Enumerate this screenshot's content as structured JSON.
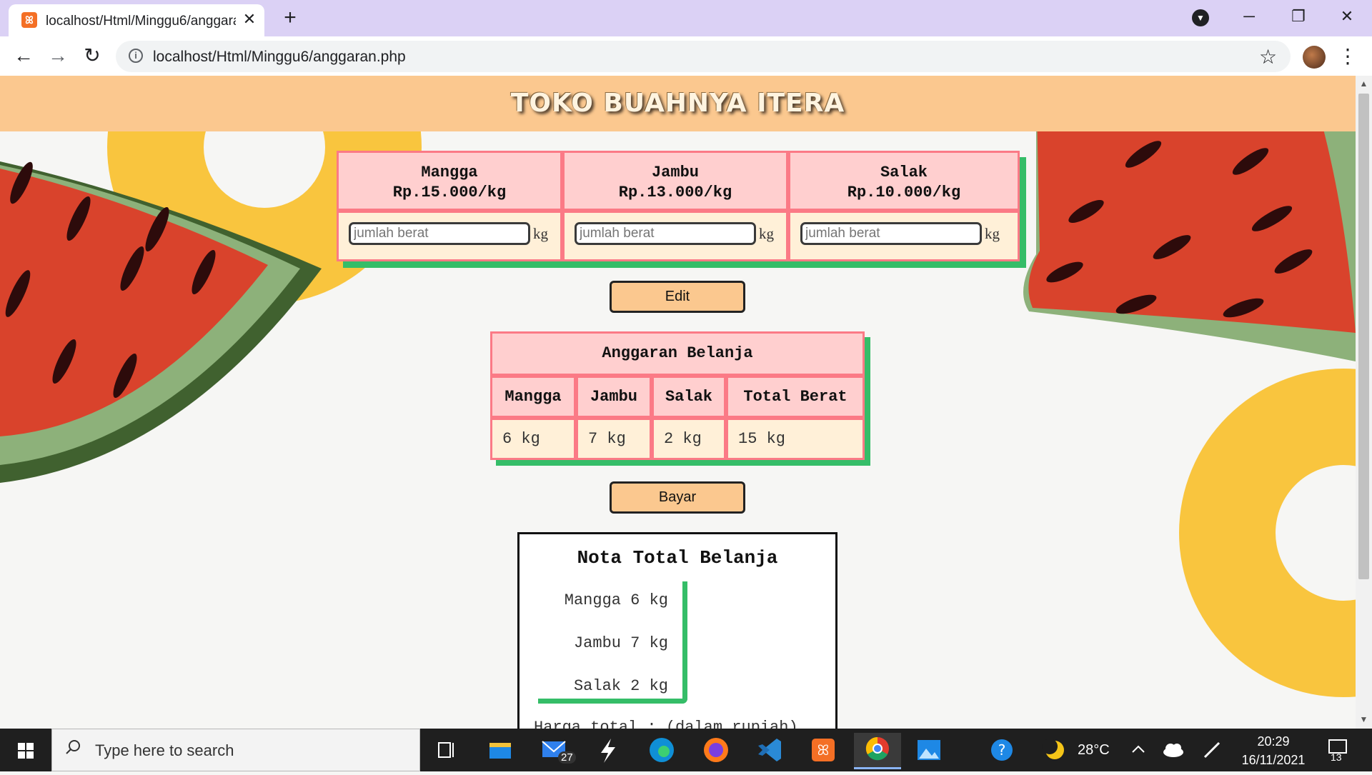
{
  "browser": {
    "tab_title": "localhost/Html/Minggu6/anggaran.php",
    "tab_close": "✕",
    "new_tab": "+",
    "url": "localhost/Html/Minggu6/anggaran.php",
    "window_min": "─",
    "window_max": "❐",
    "window_close": "✕"
  },
  "page": {
    "title": "TOKO BUAHNYA ITERA",
    "products": [
      {
        "name": "Mangga",
        "price": "Rp.15.000/kg",
        "placeholder": "jumlah berat",
        "unit": "kg"
      },
      {
        "name": "Jambu",
        "price": "Rp.13.000/kg",
        "placeholder": "jumlah berat",
        "unit": "kg"
      },
      {
        "name": "Salak",
        "price": "Rp.10.000/kg",
        "placeholder": "jumlah berat",
        "unit": "kg"
      }
    ],
    "edit_button": "Edit",
    "budget": {
      "title": "Anggaran Belanja",
      "headers": [
        "Mangga",
        "Jambu",
        "Salak",
        "Total Berat"
      ],
      "values": [
        "6 kg",
        "7 kg",
        "2 kg",
        "15 kg"
      ]
    },
    "pay_button": "Bayar",
    "receipt": {
      "title": "Nota Total Belanja",
      "items": [
        "Mangga 6 kg",
        "Jambu 7 kg",
        "Salak 2 kg"
      ],
      "total_label": "Harga total : (dalam rupiah)"
    }
  },
  "taskbar": {
    "search_placeholder": "Type here to search",
    "mail_badge": "27",
    "temperature": "28°C",
    "time": "20:29",
    "date": "16/11/2021",
    "notifications": "13"
  }
}
